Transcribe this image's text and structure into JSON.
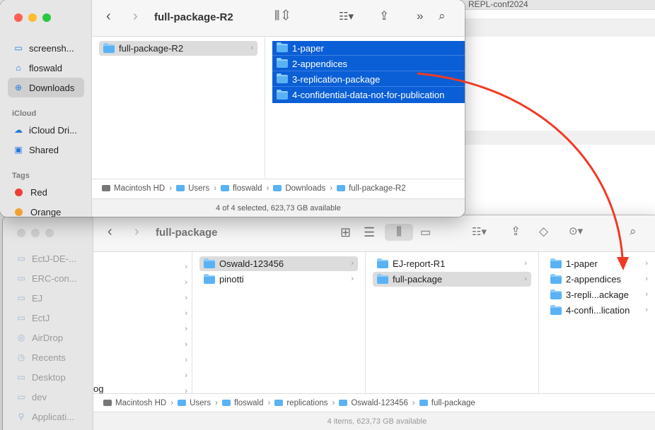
{
  "background_window": {
    "title": "REPL-conf2024"
  },
  "front_window": {
    "title": "full-package-R2",
    "sidebar": {
      "favorites": [
        {
          "label": "screensh...",
          "icon": "folder-icon"
        },
        {
          "label": "floswald",
          "icon": "home-icon"
        },
        {
          "label": "Downloads",
          "icon": "download-icon",
          "selected": true
        }
      ],
      "icloud_header": "iCloud",
      "icloud": [
        {
          "label": "iCloud Dri...",
          "icon": "cloud-icon"
        },
        {
          "label": "Shared",
          "icon": "shared-folder-icon"
        }
      ],
      "tags_header": "Tags",
      "tags": [
        {
          "label": "Red",
          "color": "#ef3d3a"
        },
        {
          "label": "Orange",
          "color": "#f3a032"
        }
      ]
    },
    "col1": [
      "full-package-R2"
    ],
    "col2": [
      "1-paper",
      "2-appendices",
      "3-replication-package",
      "4-confidential-data-not-for-publication"
    ],
    "path": [
      "Macintosh HD",
      "Users",
      "floswald",
      "Downloads",
      "full-package-R2"
    ],
    "status": "4 of 4 selected, 623,73 GB available"
  },
  "back_window": {
    "title": "full-package",
    "sidebar": [
      {
        "label": "EctJ-DE-...",
        "icon": "folder-icon"
      },
      {
        "label": "ERC-con...",
        "icon": "folder-icon"
      },
      {
        "label": "EJ",
        "icon": "folder-icon"
      },
      {
        "label": "EctJ",
        "icon": "folder-icon"
      },
      {
        "label": "AirDrop",
        "icon": "airdrop-icon"
      },
      {
        "label": "Recents",
        "icon": "clock-icon"
      },
      {
        "label": "Desktop",
        "icon": "desktop-icon"
      },
      {
        "label": "dev",
        "icon": "folder-icon"
      },
      {
        "label": "Applicati...",
        "icon": "applications-icon"
      }
    ],
    "col1_partial": "og",
    "col2": [
      "Oswald-123456",
      "pinotti"
    ],
    "col3": [
      "EJ-report-R1",
      "full-package"
    ],
    "col4": [
      "1-paper",
      "2-appendices",
      "3-repli...ackage",
      "4-confi...lication"
    ],
    "path": [
      "Macintosh HD",
      "Users",
      "floswald",
      "replications",
      "Oswald-123456",
      "full-package"
    ],
    "status": "4 items, 623,73 GB available"
  },
  "colors": {
    "selection_blue": "#0b5fd6",
    "arrow_red": "#f03a24",
    "folder_blue": "#5ab2f4"
  }
}
